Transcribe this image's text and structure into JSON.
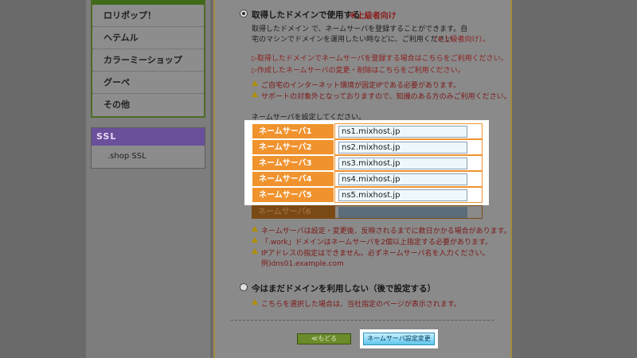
{
  "sidebar": {
    "items": [
      {
        "label": "ロリポップ！"
      },
      {
        "label": "ヘテムル"
      },
      {
        "label": "カラーミーショップ"
      },
      {
        "label": "グーペ"
      },
      {
        "label": "その他"
      }
    ],
    "ssl": {
      "heading": "SSL",
      "items": [
        {
          "label": ".shop SSL"
        }
      ]
    }
  },
  "option_own": {
    "title": "取得したドメインで使用する",
    "badge": "※上級者向け",
    "desc_line1": "取得したドメイン                で、ネームサーバを登録することができます。自",
    "desc_line2": "宅のマシンでドメインを運用したい時などに、ご利用ください",
    "desc_note": "（※上級者向け）。",
    "link1": "▷取得したドメインでネームサーバを登録する場合はこちらをご利用ください。",
    "link2": "▷作成したネームサーバの変更・削除はこちらをご利用ください。",
    "warn1": "ご自宅のインターネット環境が固定IPである必要があります。",
    "warn2": "サポートの対象外となっておりますので、知識のある方のみご利用ください。",
    "ns_prompt": "ネームサーバを設定してください。"
  },
  "nameservers": [
    {
      "label": "ネームサーバ1",
      "value": "ns1.mixhost.jp"
    },
    {
      "label": "ネームサーバ2",
      "value": "ns2.mixhost.jp"
    },
    {
      "label": "ネームサーバ3",
      "value": "ns3.mixhost.jp"
    },
    {
      "label": "ネームサーバ4",
      "value": "ns4.mixhost.jp"
    },
    {
      "label": "ネームサーバ5",
      "value": "ns5.mixhost.jp"
    },
    {
      "label": "ネームサーバ6",
      "value": ""
    }
  ],
  "ns_notes": {
    "note1": "ネームサーバは設定・変更後、反映されるまでに数日かかる場合があります。",
    "note2": "「.work」ドメインはネームサーバを2個以上指定する必要があります。",
    "note3": "IPアドレスの指定はできません。必ずネームサーバ名を入力ください。",
    "example": "例)dns01.example.com"
  },
  "option_later": {
    "title": "今はまだドメインを利用しない（後で設定する）",
    "warn": "こちらを選択した場合は、当社指定のページが表示されます。"
  },
  "buttons": {
    "back": "≪もどる",
    "submit": "ネームサーバ設定変更"
  },
  "colors": {
    "ns_label_bg": "#f0932e",
    "submit_button": "#5fc6ec",
    "back_button": "#6b8a2a",
    "ssl_header": "#6a4f9a"
  }
}
